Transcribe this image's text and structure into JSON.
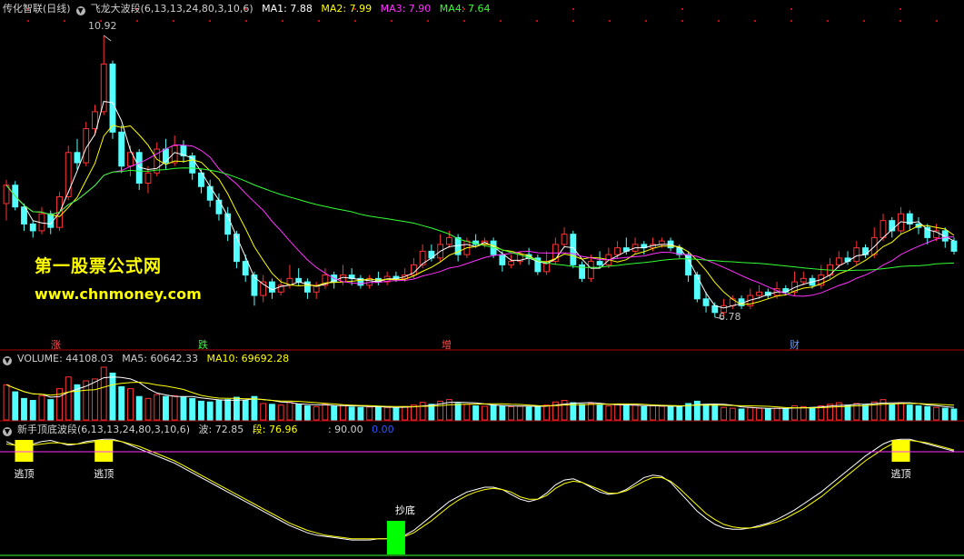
{
  "main_panel": {
    "title": "传化智联(日线)",
    "indicator": "飞龙大波段(6,13,13,24,80,3,10,6)",
    "ma1": "MA1: 7.88",
    "ma2": "MA2: 7.99",
    "ma3": "MA3: 7.90",
    "ma4": "MA4: 7.64",
    "high_label": "10.92",
    "low_label": "6.78",
    "watermark_name": "第一股票公式网",
    "watermark_url": "www.chnmoney.com",
    "signal_labels": [
      {
        "text": "涨",
        "color": "#ff5050"
      },
      {
        "text": "跌",
        "color": "#33ff33"
      },
      {
        "text": "增",
        "color": "#ff5050"
      },
      {
        "text": "财",
        "color": "#6699ff"
      }
    ]
  },
  "volume_panel": {
    "volume": "VOLUME: 44108.03",
    "ma5": "MA5: 60642.33",
    "ma10": "MA10: 69692.28"
  },
  "osc_panel": {
    "indicator": "新手顶底波段(6,13,13,24,80,3,10,6)",
    "wave": "波: 72.85",
    "segment": "段: 76.96",
    "level": ": 90.00",
    "zero": "0.00",
    "top_signal": "逃顶",
    "bottom_signal": "抄底"
  },
  "colors": {
    "up": "#ff3232",
    "down": "#54ffff",
    "ma1": "#ffffff",
    "ma2": "#ffff00",
    "ma3": "#ff33ff",
    "ma4": "#33ff33",
    "separator": "#b00000",
    "top_signal_box": "#ffff00",
    "bottom_signal_box": "#00ff00"
  },
  "chart_data": {
    "type": "candlestick",
    "price_range": [
      6.5,
      11.2
    ],
    "candles": [
      [
        8.45,
        8.72,
        8.8,
        8.2
      ],
      [
        8.72,
        8.4,
        8.78,
        8.35
      ],
      [
        8.4,
        8.15,
        8.45,
        8.05
      ],
      [
        8.15,
        8.05,
        8.2,
        7.95
      ],
      [
        8.05,
        8.3,
        8.4,
        8.0
      ],
      [
        8.3,
        8.1,
        8.35,
        8.0
      ],
      [
        8.1,
        8.55,
        8.62,
        8.05
      ],
      [
        8.55,
        9.2,
        9.3,
        8.5
      ],
      [
        9.2,
        9.05,
        9.4,
        8.95
      ],
      [
        9.05,
        9.55,
        9.65,
        9.0
      ],
      [
        9.55,
        9.8,
        9.9,
        9.45
      ],
      [
        9.8,
        10.5,
        10.92,
        9.75
      ],
      [
        10.5,
        9.5,
        10.55,
        9.4
      ],
      [
        9.5,
        9.0,
        9.6,
        8.9
      ],
      [
        9.0,
        9.2,
        9.3,
        8.85
      ],
      [
        9.2,
        8.75,
        9.25,
        8.65
      ],
      [
        8.75,
        8.9,
        9.0,
        8.6
      ],
      [
        8.9,
        9.25,
        9.35,
        8.85
      ],
      [
        9.25,
        9.05,
        9.4,
        8.95
      ],
      [
        9.05,
        9.3,
        9.45,
        9.0
      ],
      [
        9.3,
        9.15,
        9.38,
        9.05
      ],
      [
        9.15,
        8.9,
        9.2,
        8.8
      ],
      [
        8.9,
        8.7,
        8.95,
        8.6
      ],
      [
        8.7,
        8.5,
        8.8,
        8.4
      ],
      [
        8.5,
        8.3,
        8.6,
        8.2
      ],
      [
        8.3,
        8.0,
        8.4,
        7.9
      ],
      [
        8.0,
        7.6,
        8.05,
        7.5
      ],
      [
        7.6,
        7.4,
        7.7,
        7.3
      ],
      [
        7.4,
        7.1,
        7.45,
        6.95
      ],
      [
        7.1,
        7.3,
        7.4,
        7.0
      ],
      [
        7.3,
        7.15,
        7.35,
        7.05
      ],
      [
        7.15,
        7.25,
        7.35,
        7.1
      ],
      [
        7.25,
        7.35,
        7.55,
        7.2
      ],
      [
        7.35,
        7.3,
        7.5,
        7.25
      ],
      [
        7.3,
        7.15,
        7.35,
        7.05
      ],
      [
        7.15,
        7.25,
        7.3,
        7.05
      ],
      [
        7.25,
        7.4,
        7.5,
        7.2
      ],
      [
        7.4,
        7.3,
        7.45,
        7.2
      ],
      [
        7.3,
        7.4,
        7.55,
        7.25
      ],
      [
        7.4,
        7.35,
        7.5,
        7.25
      ],
      [
        7.35,
        7.25,
        7.4,
        7.2
      ],
      [
        7.25,
        7.35,
        7.4,
        7.2
      ],
      [
        7.35,
        7.3,
        7.45,
        7.25
      ],
      [
        7.3,
        7.38,
        7.45,
        7.25
      ],
      [
        7.38,
        7.35,
        7.45,
        7.3
      ],
      [
        7.35,
        7.4,
        7.5,
        7.3
      ],
      [
        7.4,
        7.55,
        7.65,
        7.35
      ],
      [
        7.55,
        7.75,
        7.85,
        7.5
      ],
      [
        7.75,
        7.65,
        7.85,
        7.6
      ],
      [
        7.65,
        7.85,
        8.0,
        7.6
      ],
      [
        7.85,
        7.95,
        8.05,
        7.8
      ],
      [
        7.95,
        7.7,
        8.0,
        7.6
      ],
      [
        7.7,
        7.9,
        7.95,
        7.65
      ],
      [
        7.9,
        7.85,
        8.0,
        7.8
      ],
      [
        7.85,
        7.9,
        7.95,
        7.8
      ],
      [
        7.9,
        7.7,
        7.95,
        7.65
      ],
      [
        7.7,
        7.55,
        7.75,
        7.45
      ],
      [
        7.55,
        7.6,
        7.7,
        7.5
      ],
      [
        7.6,
        7.7,
        7.75,
        7.55
      ],
      [
        7.7,
        7.65,
        7.8,
        7.55
      ],
      [
        7.65,
        7.45,
        7.7,
        7.4
      ],
      [
        7.45,
        7.6,
        7.75,
        7.4
      ],
      [
        7.6,
        7.85,
        7.95,
        7.55
      ],
      [
        7.85,
        8.0,
        8.1,
        7.8
      ],
      [
        8.0,
        7.55,
        8.05,
        7.5
      ],
      [
        7.55,
        7.35,
        7.6,
        7.3
      ],
      [
        7.35,
        7.6,
        7.7,
        7.3
      ],
      [
        7.6,
        7.55,
        7.75,
        7.5
      ],
      [
        7.55,
        7.7,
        7.8,
        7.5
      ],
      [
        7.7,
        7.8,
        7.9,
        7.65
      ],
      [
        7.8,
        7.75,
        7.95,
        7.7
      ],
      [
        7.75,
        7.85,
        7.95,
        7.7
      ],
      [
        7.85,
        7.8,
        7.9,
        7.7
      ],
      [
        7.8,
        7.85,
        7.95,
        7.75
      ],
      [
        7.85,
        7.9,
        7.95,
        7.8
      ],
      [
        7.9,
        7.8,
        7.95,
        7.75
      ],
      [
        7.8,
        7.7,
        7.85,
        7.65
      ],
      [
        7.7,
        7.4,
        7.75,
        7.3
      ],
      [
        7.4,
        7.05,
        7.45,
        7.0
      ],
      [
        7.05,
        6.95,
        7.15,
        6.85
      ],
      [
        6.95,
        6.85,
        7.0,
        6.78
      ],
      [
        6.85,
        6.95,
        7.05,
        6.8
      ],
      [
        6.95,
        7.05,
        7.1,
        6.9
      ],
      [
        7.05,
        6.95,
        7.1,
        6.9
      ],
      [
        6.95,
        7.1,
        7.2,
        6.9
      ],
      [
        7.1,
        7.15,
        7.25,
        7.05
      ],
      [
        7.15,
        7.1,
        7.2,
        7.05
      ],
      [
        7.1,
        7.2,
        7.3,
        7.05
      ],
      [
        7.2,
        7.15,
        7.25,
        7.1
      ],
      [
        7.15,
        7.3,
        7.45,
        7.1
      ],
      [
        7.3,
        7.35,
        7.45,
        7.25
      ],
      [
        7.35,
        7.25,
        7.4,
        7.2
      ],
      [
        7.25,
        7.4,
        7.55,
        7.2
      ],
      [
        7.4,
        7.55,
        7.65,
        7.35
      ],
      [
        7.55,
        7.65,
        7.75,
        7.5
      ],
      [
        7.65,
        7.6,
        7.75,
        7.55
      ],
      [
        7.6,
        7.8,
        7.9,
        7.55
      ],
      [
        7.8,
        7.7,
        7.85,
        7.65
      ],
      [
        7.7,
        7.95,
        8.1,
        7.65
      ],
      [
        7.95,
        8.2,
        8.3,
        7.9
      ],
      [
        8.2,
        8.05,
        8.25,
        7.95
      ],
      [
        8.05,
        8.3,
        8.4,
        8.0
      ],
      [
        8.3,
        8.15,
        8.35,
        8.05
      ],
      [
        8.15,
        8.1,
        8.25,
        8.0
      ],
      [
        8.1,
        7.95,
        8.15,
        7.85
      ],
      [
        7.95,
        8.05,
        8.15,
        7.9
      ],
      [
        8.05,
        7.9,
        8.1,
        7.8
      ],
      [
        7.9,
        7.75,
        7.95,
        7.7
      ]
    ],
    "volumes": [
      0.9,
      0.72,
      0.55,
      0.5,
      0.62,
      0.52,
      0.8,
      1.1,
      0.9,
      1.0,
      1.05,
      1.35,
      1.2,
      0.85,
      0.8,
      0.6,
      0.55,
      0.65,
      0.6,
      0.62,
      0.58,
      0.55,
      0.48,
      0.46,
      0.5,
      0.52,
      0.58,
      0.5,
      0.6,
      0.42,
      0.4,
      0.38,
      0.45,
      0.4,
      0.36,
      0.34,
      0.4,
      0.35,
      0.38,
      0.33,
      0.32,
      0.33,
      0.34,
      0.32,
      0.3,
      0.34,
      0.38,
      0.45,
      0.4,
      0.48,
      0.52,
      0.42,
      0.4,
      0.36,
      0.35,
      0.38,
      0.36,
      0.34,
      0.35,
      0.33,
      0.36,
      0.38,
      0.46,
      0.5,
      0.44,
      0.4,
      0.42,
      0.38,
      0.36,
      0.4,
      0.36,
      0.38,
      0.34,
      0.36,
      0.35,
      0.34,
      0.36,
      0.42,
      0.48,
      0.4,
      0.38,
      0.32,
      0.3,
      0.28,
      0.32,
      0.3,
      0.28,
      0.3,
      0.28,
      0.36,
      0.34,
      0.32,
      0.36,
      0.4,
      0.44,
      0.38,
      0.42,
      0.38,
      0.46,
      0.52,
      0.4,
      0.44,
      0.38,
      0.36,
      0.34,
      0.32,
      0.3,
      0.28
    ],
    "oscillator": {
      "range": [
        0,
        100
      ],
      "level": 90,
      "wave": [
        88,
        85,
        84,
        86,
        88,
        89,
        87,
        85,
        86,
        88,
        89,
        90,
        90,
        88,
        85,
        82,
        79,
        76,
        73,
        70,
        66,
        62,
        58,
        54,
        50,
        46,
        42,
        38,
        34,
        30,
        26,
        22,
        18,
        15,
        12,
        10,
        9,
        8,
        7,
        6,
        6,
        6,
        7,
        7,
        8,
        10,
        14,
        20,
        26,
        32,
        38,
        42,
        46,
        48,
        50,
        50,
        48,
        44,
        40,
        38,
        40,
        45,
        52,
        56,
        57,
        54,
        50,
        46,
        44,
        45,
        48,
        53,
        58,
        60,
        59,
        54,
        46,
        38,
        30,
        24,
        19,
        16,
        15,
        15,
        16,
        18,
        20,
        23,
        27,
        31,
        36,
        41,
        46,
        52,
        58,
        64,
        70,
        76,
        81,
        86,
        89,
        90,
        90,
        88,
        86,
        84,
        82,
        80
      ],
      "segment": [
        86,
        85,
        84,
        85,
        86,
        87,
        87,
        86,
        86,
        87,
        88,
        89,
        89,
        88,
        86,
        84,
        81,
        78,
        75,
        72,
        68,
        64,
        60,
        56,
        52,
        48,
        44,
        40,
        36,
        32,
        28,
        24,
        20,
        17,
        14,
        12,
        10,
        9,
        8,
        7,
        7,
        7,
        7,
        7,
        8,
        9,
        12,
        17,
        22,
        28,
        34,
        39,
        43,
        46,
        48,
        49,
        48,
        46,
        42,
        40,
        40,
        43,
        49,
        53,
        55,
        54,
        51,
        48,
        45,
        45,
        47,
        51,
        55,
        58,
        58,
        55,
        49,
        42,
        35,
        28,
        23,
        19,
        17,
        16,
        16,
        17,
        19,
        21,
        24,
        28,
        32,
        37,
        42,
        48,
        54,
        60,
        66,
        72,
        77,
        82,
        86,
        88,
        89,
        88,
        87,
        85,
        83,
        81
      ],
      "top_signals": [
        2,
        11,
        101
      ],
      "bottom_signals": [
        44
      ]
    }
  }
}
